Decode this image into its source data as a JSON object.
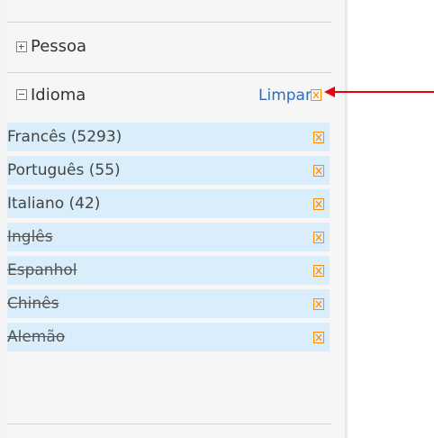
{
  "facets": {
    "pessoa": {
      "title": "Pessoa",
      "expanded": false
    },
    "idioma": {
      "title": "Idioma",
      "expanded": true,
      "clear_label": "Limpar",
      "items": [
        {
          "label": "Francês (5293)",
          "active": true
        },
        {
          "label": "Português (55)",
          "active": true
        },
        {
          "label": "Italiano (42)",
          "active": true
        },
        {
          "label": "Inglês",
          "active": false
        },
        {
          "label": "Espanhol",
          "active": false
        },
        {
          "label": "Chinês",
          "active": false
        },
        {
          "label": "Alemão",
          "active": false
        }
      ]
    }
  },
  "colors": {
    "item_background": "#d9eefa",
    "remove_icon": "#ff8c00",
    "link": "#2a6ebb",
    "annotation_arrow": "#e8000a"
  }
}
